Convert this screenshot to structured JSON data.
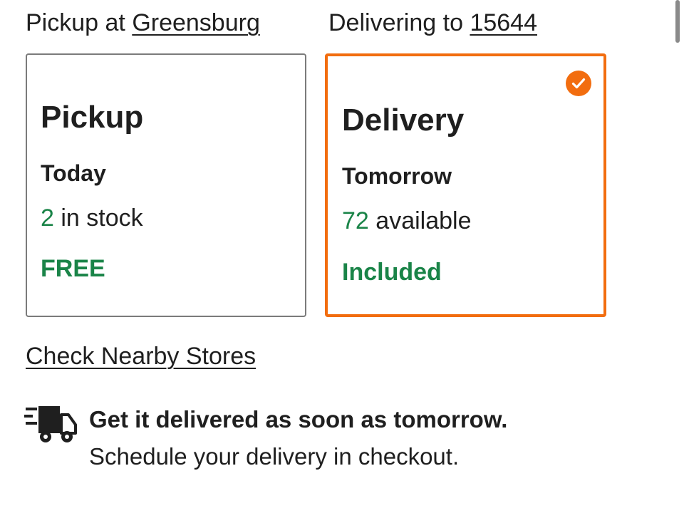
{
  "fulfillment": {
    "pickup_location": {
      "prefix": "Pickup at",
      "store": "Greensburg"
    },
    "delivery_location": {
      "prefix": "Delivering to",
      "zip": "15644"
    },
    "pickup_card": {
      "title": "Pickup",
      "when": "Today",
      "stock_count": "2",
      "stock_label": "in stock",
      "price": "FREE",
      "selected": false
    },
    "delivery_card": {
      "title": "Delivery",
      "when": "Tomorrow",
      "stock_count": "72",
      "stock_label": "available",
      "price": "Included",
      "selected": true,
      "selected_icon": "check-circle-icon"
    },
    "nearby_link": "Check Nearby Stores"
  },
  "delivery_promo": {
    "icon": "delivery-truck-icon",
    "title": "Get it delivered as soon as tomorrow.",
    "subtitle": "Schedule your delivery in checkout."
  },
  "colors": {
    "accent": "#f26d0f",
    "success_green": "#1a8448",
    "text": "#1f1f1f",
    "border_gray": "#7b7b7b"
  }
}
